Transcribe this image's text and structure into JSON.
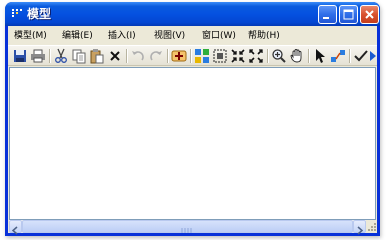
{
  "window": {
    "title": "模型"
  },
  "menubar": {
    "items": [
      {
        "label": "模型(M)"
      },
      {
        "label": "编辑(E)"
      },
      {
        "label": "插入(I)"
      },
      {
        "label": "视图(V)"
      },
      {
        "label": "窗口(W)"
      },
      {
        "label": "帮助(H)"
      }
    ]
  },
  "toolbar": {
    "icons": [
      "save-icon",
      "print-icon",
      "cut-icon",
      "copy-icon",
      "paste-icon",
      "delete-icon",
      "undo-icon",
      "redo-icon",
      "add-icon",
      "color-grid-icon",
      "zoom-fit-icon",
      "shrink-icon",
      "expand-icon",
      "zoom-in-icon",
      "pan-hand-icon",
      "pointer-icon",
      "connect-icon",
      "check-icon",
      "run-icon"
    ]
  },
  "colors": {
    "titlebar": "#0551e0",
    "frame": "#ece9d8",
    "close": "#d9512f"
  }
}
